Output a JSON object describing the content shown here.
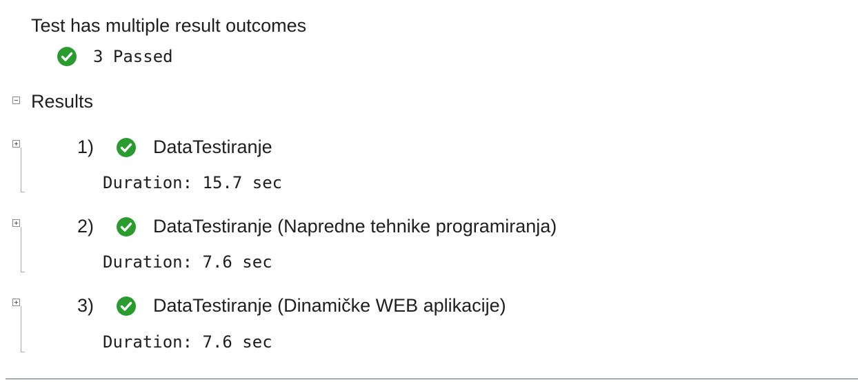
{
  "summary": {
    "title": "Test has multiple result outcomes",
    "outcome_text": "3 Passed",
    "outcome_icon": "check-circle-icon"
  },
  "results": {
    "header": "Results",
    "collapse_glyph": "minus",
    "expand_glyph": "plus",
    "items": [
      {
        "index": "1)",
        "name": "DataTestiranje",
        "duration": "Duration: 15.7 sec",
        "status": "passed"
      },
      {
        "index": "2)",
        "name": "DataTestiranje (Napredne tehnike programiranja)",
        "duration": "Duration: 7.6 sec",
        "status": "passed"
      },
      {
        "index": "3)",
        "name": "DataTestiranje (Dinamičke WEB aplikacije)",
        "duration": "Duration: 7.6 sec",
        "status": "passed"
      }
    ]
  },
  "colors": {
    "passed": "#2a9c2f",
    "text": "#1e1e1e",
    "tree_line": "#a9a9a9",
    "bottom_rule": "#56606f"
  }
}
